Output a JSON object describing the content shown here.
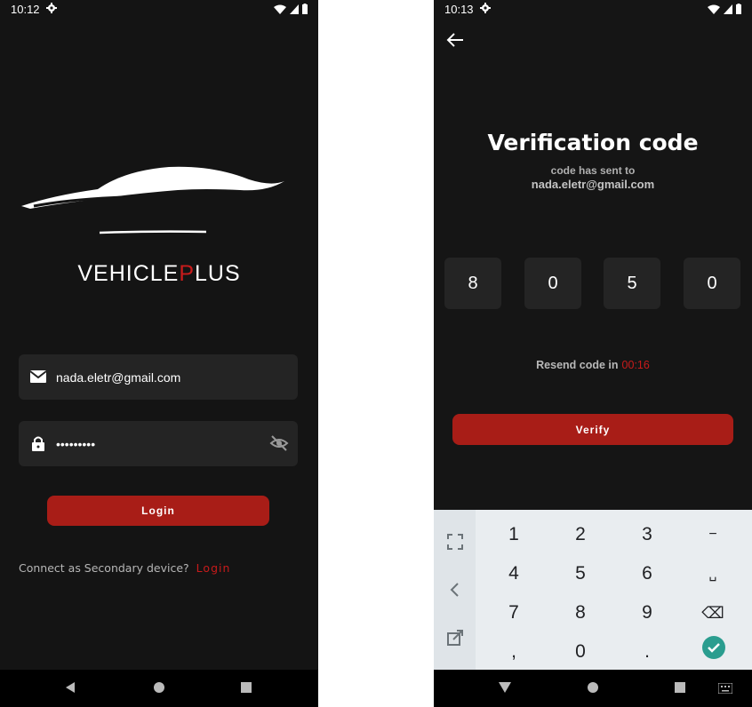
{
  "left_screen": {
    "status": {
      "time": "10:12"
    },
    "brand": {
      "part1": "VEHICLE",
      "accent": "P",
      "part2": "LUS"
    },
    "email": {
      "value": "nada.eletr@gmail.com",
      "icon": "mail-icon"
    },
    "password": {
      "value": "•••••••••",
      "icon": "lock-icon",
      "toggle_icon": "eye-off-icon"
    },
    "login_button": "Login",
    "secondary": {
      "text": "Connect as Secondary device?",
      "link": "Login"
    },
    "colors": {
      "accent": "#c81b1b",
      "button": "#a81d17",
      "background": "#141414",
      "field": "#242424"
    }
  },
  "right_screen": {
    "status": {
      "time": "10:13"
    },
    "title": "Verification code",
    "subtitle_line1": "code has sent to",
    "subtitle_line2": "nada.eletr@gmail.com",
    "code_digits": [
      "8",
      "0",
      "5",
      "0"
    ],
    "resend": {
      "label": "Resend code in",
      "timer": "00:16"
    },
    "verify_button": "Verify",
    "keyboard": {
      "keys": [
        [
          "1",
          "2",
          "3",
          "−"
        ],
        [
          "4",
          "5",
          "6",
          "␣"
        ],
        [
          "7",
          "8",
          "9",
          "⌫"
        ],
        [
          ",",
          "0",
          ".",
          "✓"
        ]
      ]
    }
  }
}
